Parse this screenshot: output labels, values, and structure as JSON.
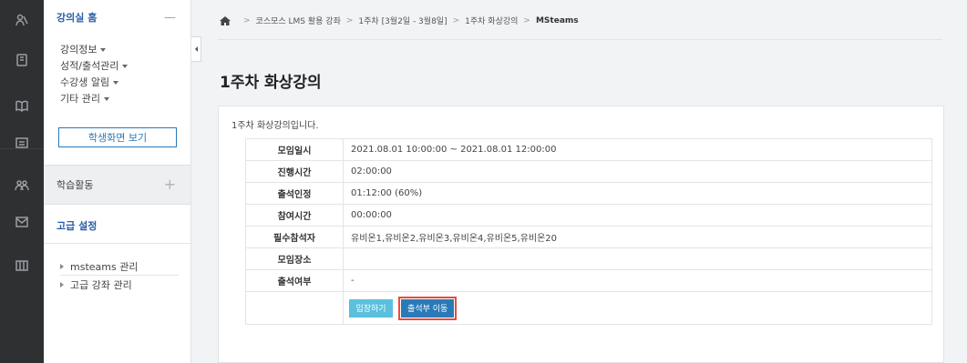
{
  "sidebar": {
    "title": "강의실 홈",
    "collapse_symbol": "—",
    "menu": [
      {
        "label": "강의정보"
      },
      {
        "label": "성적/출석관리"
      },
      {
        "label": "수강생 알림"
      },
      {
        "label": "기타 관리"
      }
    ],
    "student_view_label": "학생화면 보기",
    "activities_label": "학습활동",
    "activities_plus": "+",
    "advanced_title": "고급 설정",
    "advanced_items": [
      {
        "label": "msteams 관리"
      },
      {
        "label": "고급 강좌 관리"
      }
    ]
  },
  "rail": {
    "icons": [
      "people-icon",
      "note-icon",
      "book-icon",
      "board-icon",
      "group-icon",
      "mail-icon",
      "library-icon"
    ]
  },
  "breadcrumb": {
    "items": [
      "코스모스 LMS 활용 강좌",
      "1주차 [3월2일 - 3월8일]",
      "1주차 화상강의"
    ],
    "current": "MSteams",
    "separator": ">"
  },
  "page": {
    "title": "1주차 화상강의",
    "intro": "1주차 화상강의입니다."
  },
  "meeting_info": [
    {
      "label": "모임일시",
      "value": "2021.08.01 10:00:00 ~ 2021.08.01 12:00:00"
    },
    {
      "label": "진행시간",
      "value": "02:00:00"
    },
    {
      "label": "출석인정",
      "value": "01:12:00 (60%)"
    },
    {
      "label": "참여시간",
      "value": "00:00:00"
    },
    {
      "label": "필수참석자",
      "value": "유비온1,유비온2,유비온3,유비온4,유비온5,유비온20"
    },
    {
      "label": "모임장소",
      "value": ""
    },
    {
      "label": "출석여부",
      "value": "-"
    }
  ],
  "actions": {
    "enter_label": "입장하기",
    "attendance_label": "출석부 이동"
  },
  "colors": {
    "rail_bg": "#2f3032",
    "link_blue": "#2a5ea8",
    "enter_btn": "#5bc0de",
    "attendance_btn": "#2a7ab8",
    "highlight": "#e84c3d"
  }
}
